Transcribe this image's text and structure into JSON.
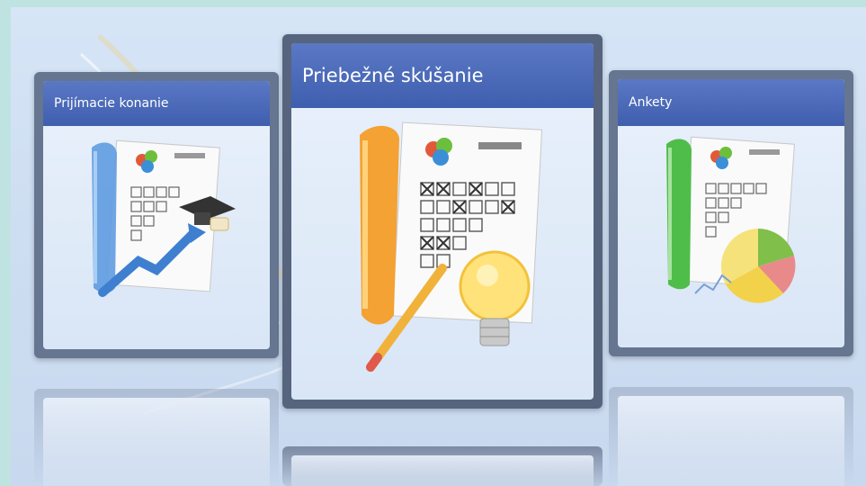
{
  "cards": {
    "left": {
      "title": "Prijímacie konanie",
      "icon": "admissions-document-icon"
    },
    "center": {
      "title": "Priebežné skúšanie",
      "icon": "test-sheet-lightbulb-icon"
    },
    "right": {
      "title": "Ankety",
      "icon": "survey-pie-chart-icon"
    }
  },
  "colors": {
    "header_blue": "#3f5eae",
    "card_frame": "#5f6e88",
    "background": "#d2e1f3"
  }
}
